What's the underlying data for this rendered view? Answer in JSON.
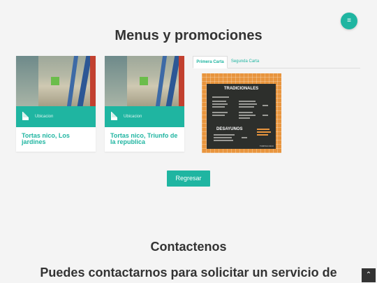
{
  "nav": {
    "menu_icon": "hamburger-icon"
  },
  "page": {
    "title": "Menus y promociones"
  },
  "cards": [
    {
      "location_label": "Ubicacion",
      "name": "Tortas nico, Los jardines"
    },
    {
      "location_label": "Ubicacion",
      "name": "Tortas nico, Triunfo de la republica"
    }
  ],
  "tabs": [
    {
      "label": "Primera Carta",
      "active": true
    },
    {
      "label": "Segunda Carta",
      "active": false
    }
  ],
  "menu_board": {
    "heading": "TRADICIONALES",
    "section": "DESAYUNOS",
    "footer": "TORTAS NICO"
  },
  "actions": {
    "back_label": "Regresar"
  },
  "contact": {
    "title": "Contactenos",
    "subtitle": "Puedes contactarnos para solicitar un servicio de"
  },
  "scroll_top": {
    "icon": "chevron-up-icon"
  },
  "colors": {
    "accent": "#1fb5a1",
    "background": "#f4f4f4",
    "menu_frame": "#e8953e"
  }
}
